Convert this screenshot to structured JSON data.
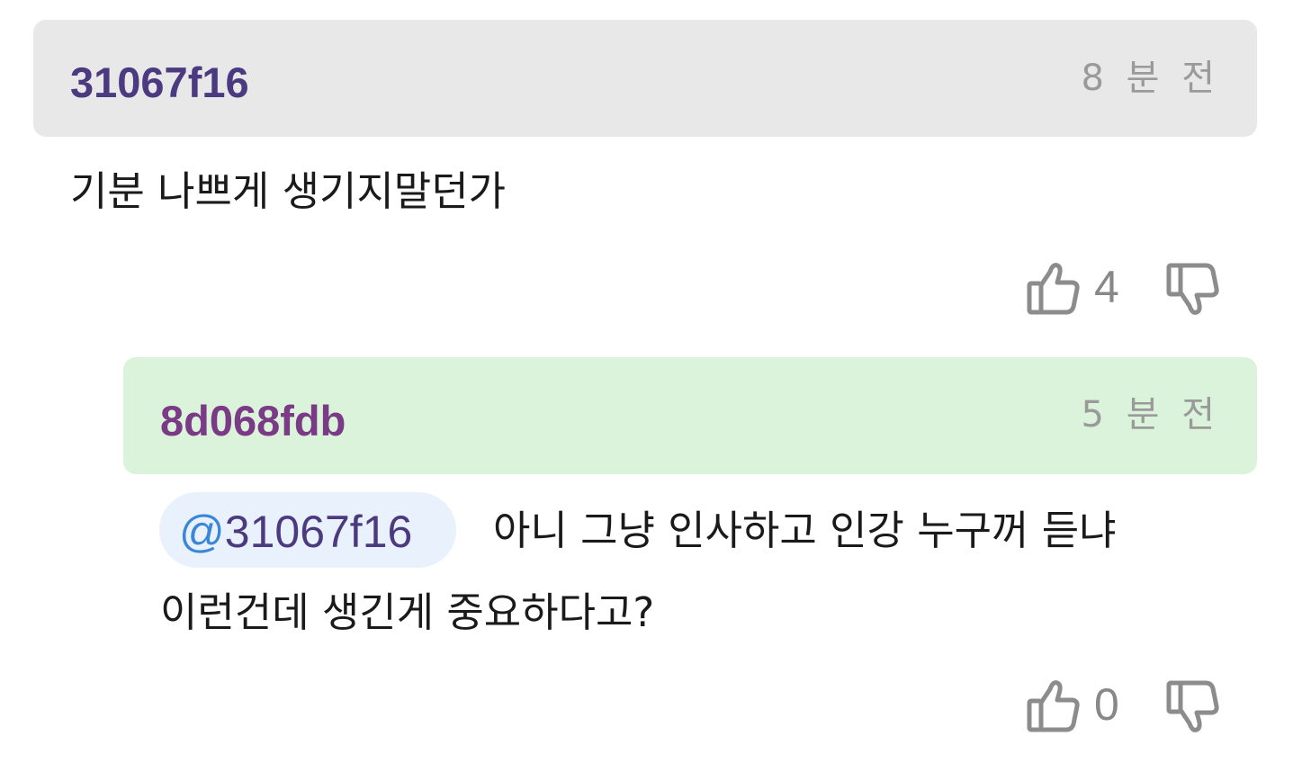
{
  "comments": [
    {
      "author": "31067f16",
      "time": "8 분 전",
      "text": "기분 나쁘게 생기지말던가",
      "likes": "4"
    },
    {
      "author": "8d068fdb",
      "time": "5 분 전",
      "mention_at": "@",
      "mention_handle": "31067f16",
      "text_line1": "아니 그냥 인사하고 인강 누구꺼 듣냐",
      "text_line2": "이런건데 생긴게 중요하다고?",
      "likes": "0"
    }
  ],
  "icons": {
    "like": "thumbs-up-icon",
    "dislike": "thumbs-down-icon"
  },
  "colors": {
    "reply_header_bg": "#dbf3da",
    "comment_header_bg": "#e8e8e8",
    "author1": "#4b3a80",
    "author2": "#7b3a86",
    "mention_bg": "#e9f1fc",
    "mention_at": "#3a86d8"
  }
}
